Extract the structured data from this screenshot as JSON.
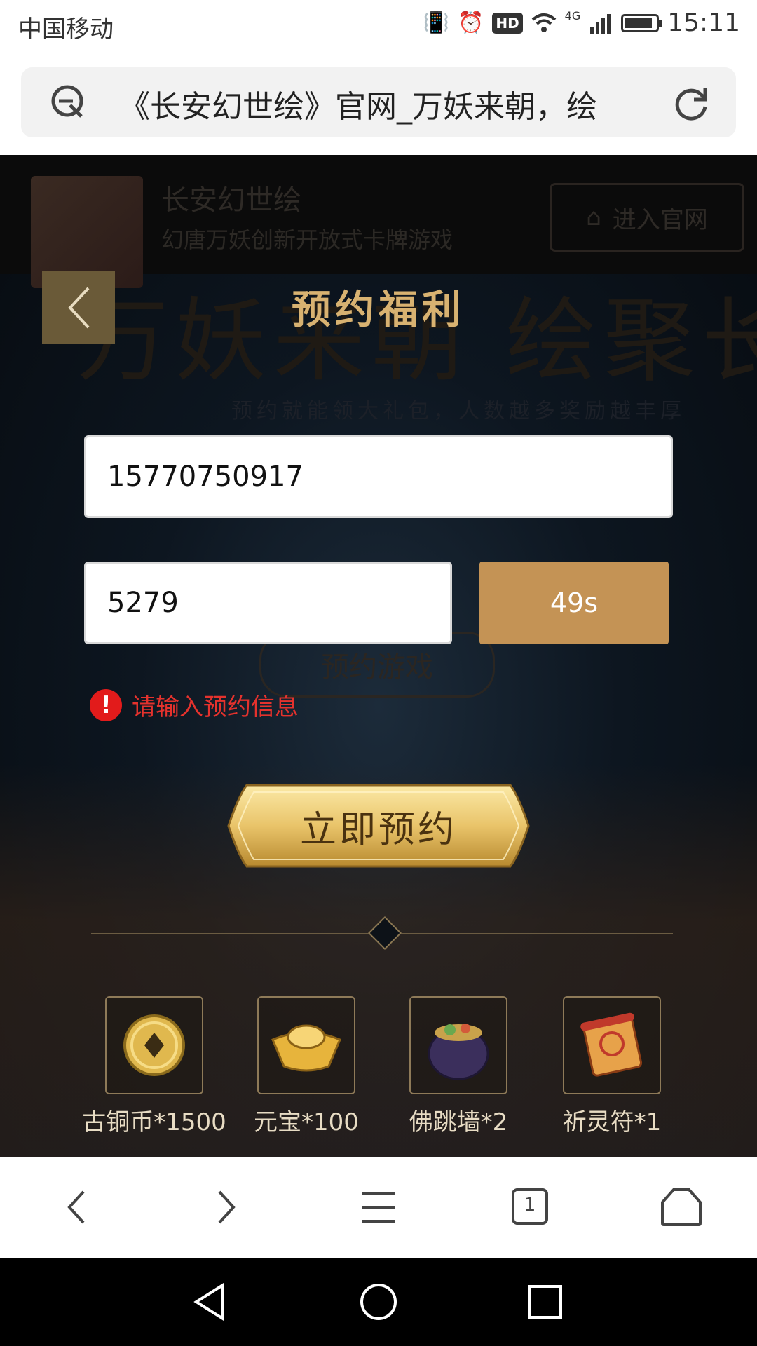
{
  "status_bar": {
    "carrier": "中国移动",
    "network": "4G",
    "hd": "HD",
    "time": "15:11",
    "battery_level": 0.9
  },
  "address_bar": {
    "page_title": "《长安幻世绘》官网_万妖来朝，绘"
  },
  "background": {
    "app_name": "长安幻世绘",
    "app_tagline": "幻唐万妖创新开放式卡牌游戏",
    "enter_site_label": "进入官网",
    "banner_text": "万妖来朝 绘聚长安",
    "sub_banner": "预约就能领大礼包，人数越多奖励越丰厚",
    "reserve_game_label": "预约游戏"
  },
  "modal": {
    "title": "预约福利",
    "phone_value": "15770750917",
    "code_value": "5279",
    "countdown_label": "49s",
    "error_message": "请输入预约信息",
    "submit_label": "立即预约"
  },
  "rewards": [
    {
      "label": "古铜币*1500",
      "icon": "coin-icon"
    },
    {
      "label": "元宝*100",
      "icon": "gold-ingot-icon"
    },
    {
      "label": "佛跳墙*2",
      "icon": "pot-icon"
    },
    {
      "label": "祈灵符*1",
      "icon": "scroll-icon"
    }
  ],
  "browser_nav": {
    "tab_count": "1"
  },
  "colors": {
    "accent_gold": "#c49355",
    "title_gold": "#d8b271",
    "error_red": "#e5322d"
  }
}
